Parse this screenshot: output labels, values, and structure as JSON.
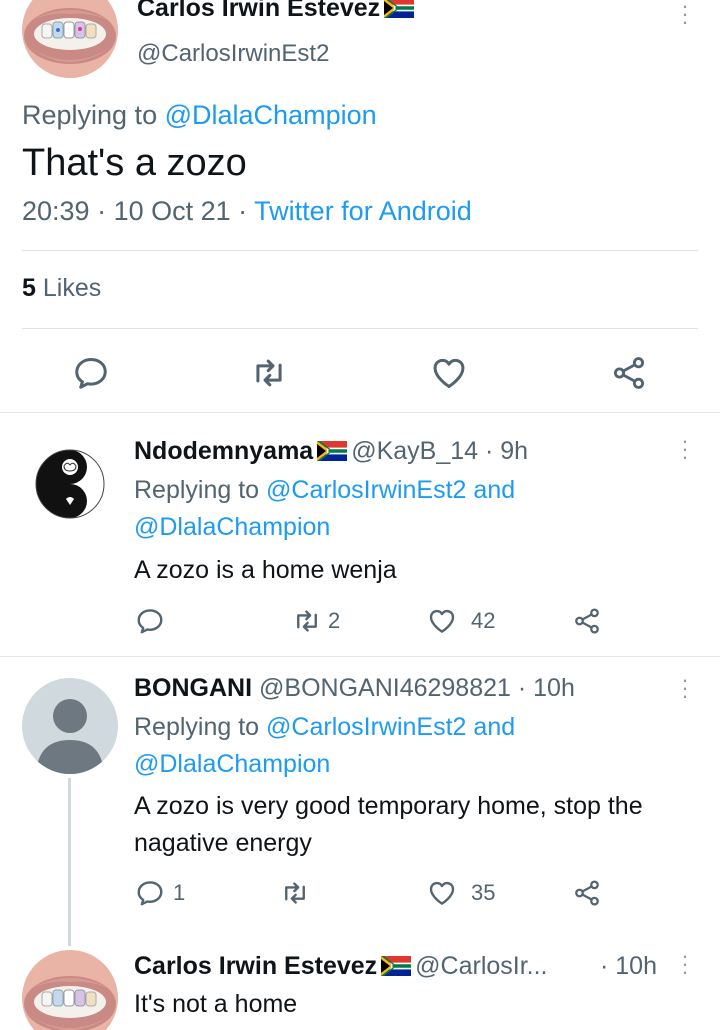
{
  "main_tweet": {
    "author_name": "Carlos Irwin Estevez",
    "author_handle": "@CarlosIrwinEst2",
    "replying_prefix": "Replying to",
    "replying_to": "@DlalaChampion",
    "text": "That's a zozo",
    "time": "20:39",
    "date": "10 Oct 21",
    "source": "Twitter for Android",
    "likes_count": "5",
    "likes_label": "Likes"
  },
  "icons": {
    "reply": "reply-icon",
    "retweet": "retweet-icon",
    "like": "heart-icon",
    "share": "share-icon",
    "more": "more-icon",
    "flag": "south-africa-flag-icon"
  },
  "colors": {
    "link": "#1d9bf0",
    "muted": "#536471",
    "text": "#0f1419"
  },
  "replies": [
    {
      "name": "Ndodemnyama",
      "handle": "@KayB_14",
      "time": "9h",
      "replying_prefix": "Replying to",
      "replying_to_1": "@CarlosIrwinEst2",
      "replying_and": "and",
      "replying_to_2": "@DlalaChampion",
      "text": "A zozo is a home wenja",
      "reply_count": "",
      "retweet_count": "2",
      "like_count": "42"
    },
    {
      "name": "BONGANI",
      "handle": "@BONGANI46298821",
      "time": "10h",
      "replying_prefix": "Replying to",
      "replying_to_1": "@CarlosIrwinEst2",
      "replying_and": "and",
      "replying_to_2": "@DlalaChampion",
      "text": "A zozo is very good temporary home, stop the nagative energy",
      "reply_count": "1",
      "retweet_count": "",
      "like_count": "35"
    },
    {
      "name": "Carlos Irwin Estevez",
      "handle": "@CarlosIr...",
      "time": "10h",
      "text": "It's not a home"
    }
  ]
}
